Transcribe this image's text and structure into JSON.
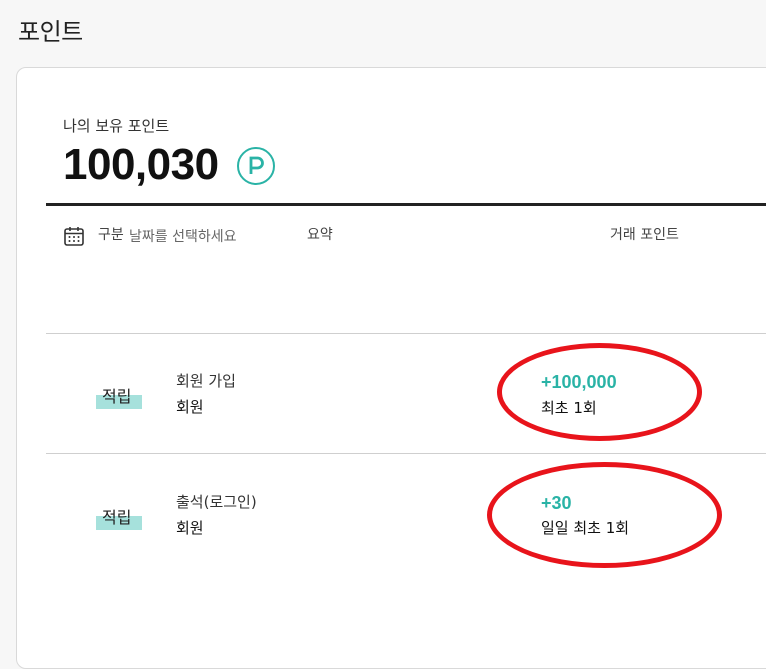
{
  "page": {
    "title": "포인트"
  },
  "summary": {
    "label": "나의 보유 포인트",
    "total": "100,030",
    "badge_letter": "P"
  },
  "date_filter": {
    "placeholder": "날짜를 선택하세요"
  },
  "table": {
    "headers": [
      "구분",
      "요약",
      "거래 포인트"
    ],
    "rows": [
      {
        "type": "적립",
        "title": "회원 가입",
        "sub": "회원",
        "amount": "+100,000",
        "note": "최초 1회"
      },
      {
        "type": "적립",
        "title": "출석(로그인)",
        "sub": "회원",
        "amount": "+30",
        "note": "일일 최초 1회"
      }
    ]
  },
  "colors": {
    "accent": "#2ab3a6",
    "highlight": "#a6e1dc",
    "annotation": "#e8141b"
  }
}
